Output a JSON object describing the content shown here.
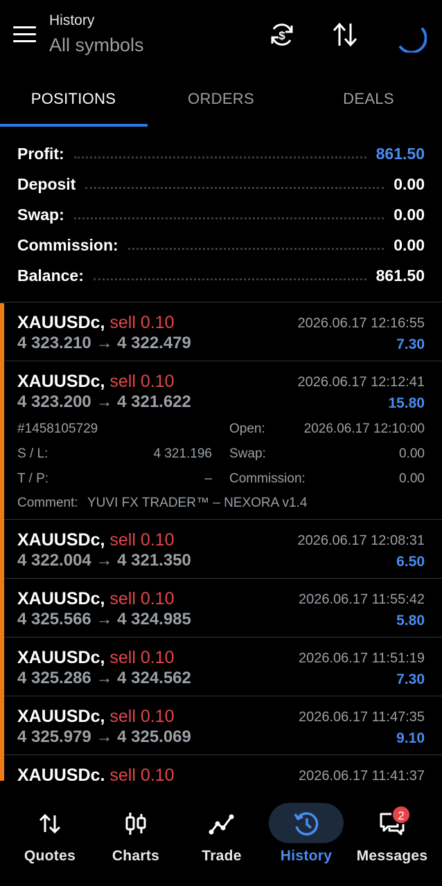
{
  "header": {
    "title": "History",
    "subtitle": "All symbols",
    "icons": [
      "menu-icon",
      "sync-currency-icon",
      "sort-icon",
      "loading-spinner-icon"
    ]
  },
  "tabs": [
    {
      "label": "POSITIONS",
      "active": true
    },
    {
      "label": "ORDERS",
      "active": false
    },
    {
      "label": "DEALS",
      "active": false
    }
  ],
  "summary": {
    "profit_label": "Profit:",
    "profit_value": "861.50",
    "deposit_label": "Deposit",
    "deposit_value": "0.00",
    "swap_label": "Swap:",
    "swap_value": "0.00",
    "commission_label": "Commission:",
    "commission_value": "0.00",
    "balance_label": "Balance:",
    "balance_value": "861.50"
  },
  "positions": [
    {
      "symbol": "XAUUSDc,",
      "side": "sell 0.10",
      "prices": "4 323.210 → 4 322.479",
      "time": "2026.06.17 12:16:55",
      "profit": "7.30"
    },
    {
      "symbol": "XAUUSDc,",
      "side": "sell 0.10",
      "prices": "4 323.200 → 4 321.622",
      "time": "2026.06.17 12:12:41",
      "profit": "15.80",
      "details": {
        "ticket": "#1458105729",
        "open_label": "Open:",
        "open_value": "2026.06.17 12:10:00",
        "sl_label": "S / L:",
        "sl_value": "4 321.196",
        "swap_label": "Swap:",
        "swap_value": "0.00",
        "tp_label": "T / P:",
        "tp_value": "–",
        "commission_label": "Commission:",
        "commission_value": "0.00",
        "comment_label": "Comment:",
        "comment_value": "YUVI FX TRADER™ – NEXORA v1.4"
      }
    },
    {
      "symbol": "XAUUSDc,",
      "side": "sell 0.10",
      "prices": "4 322.004 → 4 321.350",
      "time": "2026.06.17 12:08:31",
      "profit": "6.50"
    },
    {
      "symbol": "XAUUSDc,",
      "side": "sell 0.10",
      "prices": "4 325.566 → 4 324.985",
      "time": "2026.06.17 11:55:42",
      "profit": "5.80"
    },
    {
      "symbol": "XAUUSDc,",
      "side": "sell 0.10",
      "prices": "4 325.286 → 4 324.562",
      "time": "2026.06.17 11:51:19",
      "profit": "7.30"
    },
    {
      "symbol": "XAUUSDc,",
      "side": "sell 0.10",
      "prices": "4 325.979 → 4 325.069",
      "time": "2026.06.17 11:47:35",
      "profit": "9.10"
    },
    {
      "symbol": "XAUUSDc,",
      "side": "sell 0.10",
      "prices": "",
      "time": "2026.06.17 11:41:37",
      "profit": ""
    }
  ],
  "nav": {
    "items": [
      {
        "label": "Quotes",
        "icon": "quotes-icon",
        "active": false
      },
      {
        "label": "Charts",
        "icon": "charts-icon",
        "active": false
      },
      {
        "label": "Trade",
        "icon": "trade-icon",
        "active": false
      },
      {
        "label": "History",
        "icon": "history-icon",
        "active": true
      },
      {
        "label": "Messages",
        "icon": "messages-icon",
        "active": false
      }
    ],
    "messages_badge": "2"
  },
  "colors": {
    "accent_blue": "#4a8cf0",
    "sell_red": "#e5454b",
    "position_bar": "#f07a15",
    "muted_text": "#9aa0a6"
  }
}
